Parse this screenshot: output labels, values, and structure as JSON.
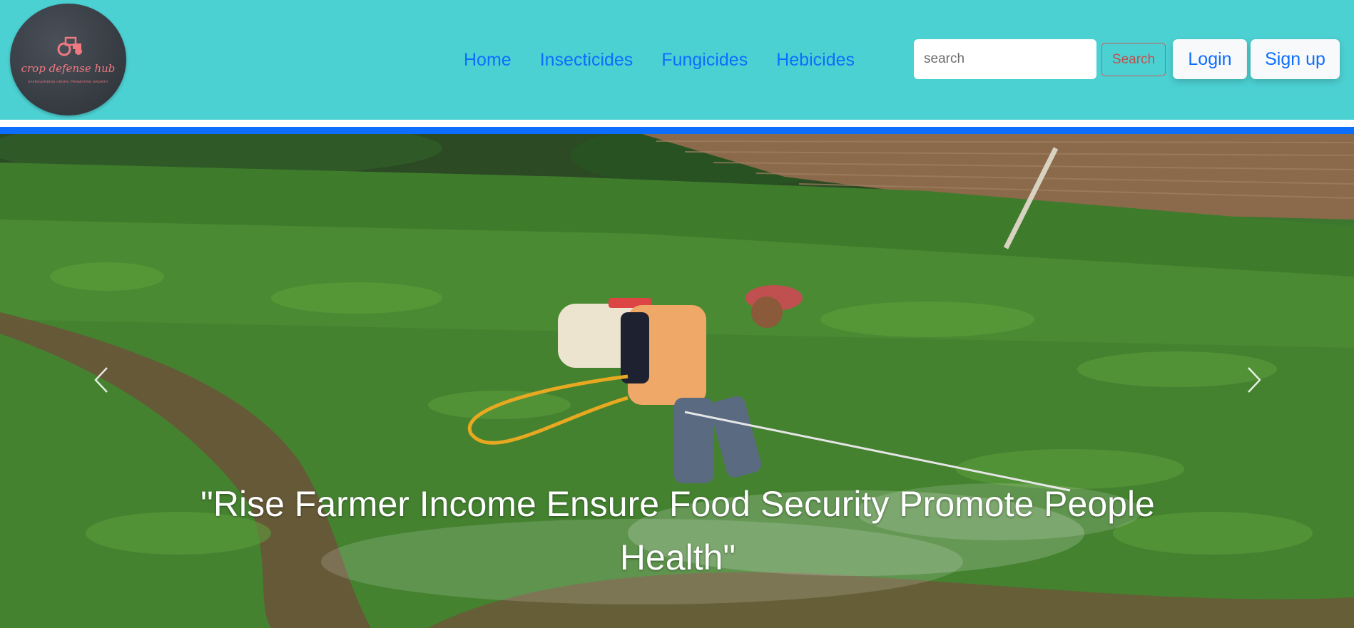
{
  "brand": {
    "name": "crop defense hub",
    "tagline": "SAFEGUARDING CROPS, PROMOTING GROWTH",
    "accent_color": "#f07880",
    "logo_icon": "tractor-icon"
  },
  "nav": {
    "items": [
      {
        "label": "Home"
      },
      {
        "label": "Insecticides"
      },
      {
        "label": "Fungicides"
      },
      {
        "label": "Hebicides"
      }
    ],
    "link_color": "#0d6efd"
  },
  "search": {
    "placeholder": "search",
    "button_label": "Search"
  },
  "auth": {
    "login_label": "Login",
    "signup_label": "Sign up"
  },
  "hero": {
    "caption": "\"Rise Farmer Income Ensure Food Security Promote People Health\"",
    "prev_icon": "chevron-left-icon",
    "next_icon": "chevron-right-icon"
  },
  "colors": {
    "header_bg": "#4cd1d3",
    "divider": "#0d6efd"
  }
}
